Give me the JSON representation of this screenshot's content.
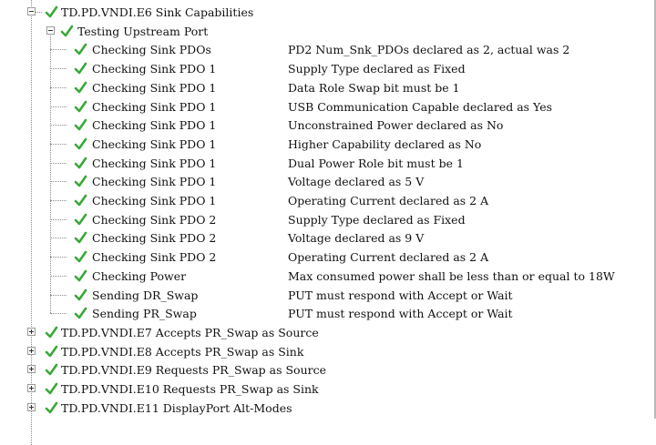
{
  "tree": {
    "groups_before": [],
    "expanded_group": {
      "label": "TD.PD.VNDI.E6 Sink Capabilities",
      "subgroup": {
        "label": "Testing Upstream Port",
        "checks": [
          {
            "name": "Checking Sink PDOs",
            "detail": "PD2 Num_Snk_PDOs declared as 2, actual was 2"
          },
          {
            "name": "Checking Sink PDO 1",
            "detail": "Supply Type declared as Fixed"
          },
          {
            "name": "Checking Sink PDO 1",
            "detail": "Data Role Swap bit must be 1"
          },
          {
            "name": "Checking Sink PDO 1",
            "detail": "USB Communication Capable declared as Yes"
          },
          {
            "name": "Checking Sink PDO 1",
            "detail": "Unconstrained Power declared as No"
          },
          {
            "name": "Checking Sink PDO 1",
            "detail": "Higher Capability declared as No"
          },
          {
            "name": "Checking Sink PDO 1",
            "detail": "Dual Power Role bit must be 1"
          },
          {
            "name": "Checking Sink PDO 1",
            "detail": "Voltage declared as 5 V"
          },
          {
            "name": "Checking Sink PDO 1",
            "detail": "Operating Current declared as 2 A"
          },
          {
            "name": "Checking Sink PDO 2",
            "detail": "Supply Type declared as Fixed"
          },
          {
            "name": "Checking Sink PDO 2",
            "detail": "Voltage declared as 9 V"
          },
          {
            "name": "Checking Sink PDO 2",
            "detail": "Operating Current declared as 2 A"
          },
          {
            "name": "Checking Power",
            "detail": "Max consumed power shall be less than or equal to 18W"
          },
          {
            "name": "Sending DR_Swap",
            "detail": "PUT must respond with Accept or Wait"
          },
          {
            "name": "Sending PR_Swap",
            "detail": "PUT must respond with Accept or Wait"
          }
        ]
      }
    },
    "collapsed_groups": [
      {
        "label": "TD.PD.VNDI.E7 Accepts PR_Swap as Source"
      },
      {
        "label": "TD.PD.VNDI.E8 Accepts PR_Swap as Sink"
      },
      {
        "label": "TD.PD.VNDI.E9 Requests PR_Swap as Source"
      },
      {
        "label": "TD.PD.VNDI.E10 Requests PR_Swap as Sink"
      },
      {
        "label": "TD.PD.VNDI.E11 DisplayPort Alt-Modes"
      }
    ]
  },
  "colors": {
    "pass_check": "#3aa83a",
    "tree_lines": "#8c8c8c",
    "text": "#111111",
    "background": "#ffffff"
  },
  "icons": {
    "pass": "green-check-icon",
    "expand": "plus-box-icon",
    "collapse": "minus-box-icon"
  }
}
